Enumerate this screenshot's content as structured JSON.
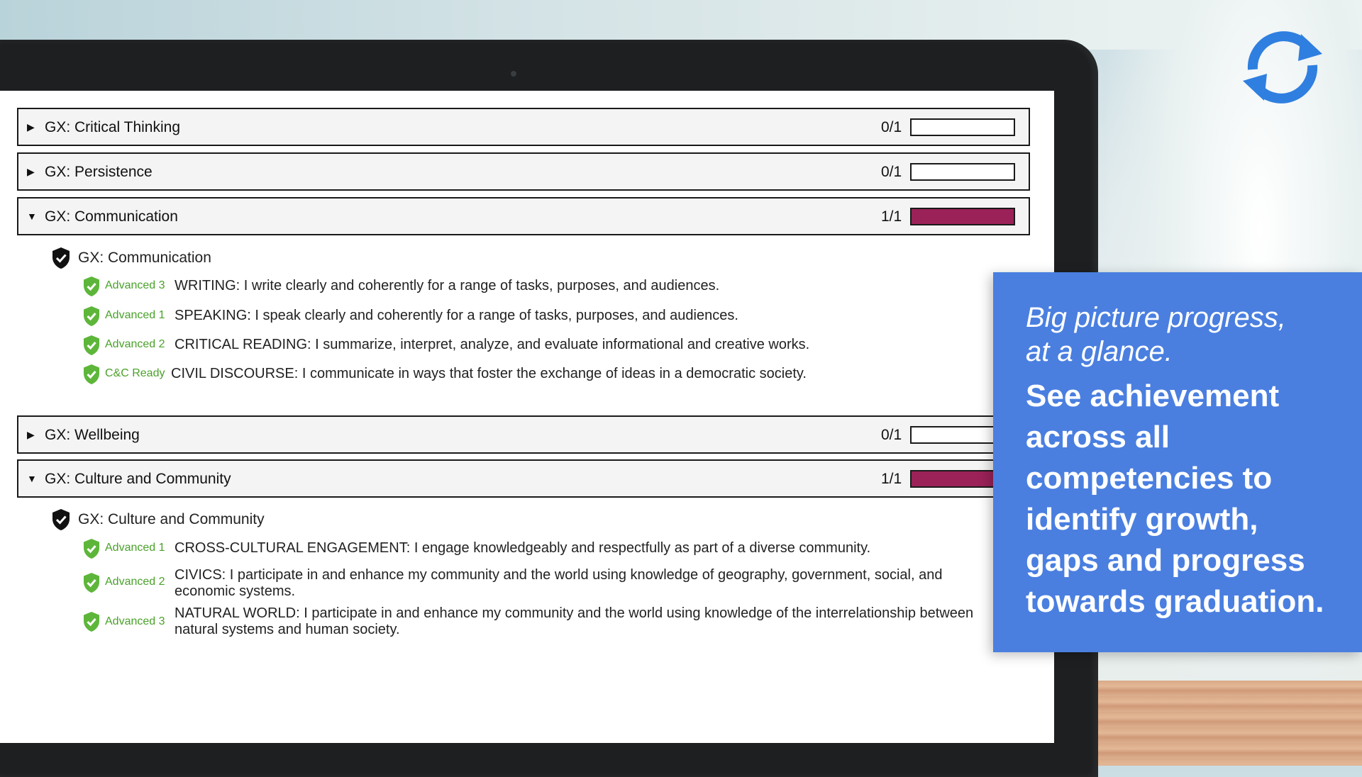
{
  "colors": {
    "progress_fill": "#9b2259",
    "level_green": "#4aa12a",
    "callout_bg": "#4a7fe0",
    "sync_icon": "#2f7fe0"
  },
  "icons": {
    "sync": "sync-icon",
    "collapsed": "caret-right-icon",
    "expanded": "caret-down-icon",
    "group_shield": "shield-check-icon",
    "standard_shield": "green-shield-check-icon"
  },
  "competencies": [
    {
      "title": "GX: Critical Thinking",
      "count": "0/1",
      "progress": 0,
      "expanded": false
    },
    {
      "title": "GX: Persistence",
      "count": "0/1",
      "progress": 0,
      "expanded": false
    },
    {
      "title": "GX: Communication",
      "count": "1/1",
      "progress": 1,
      "expanded": true,
      "group_title": "GX: Communication",
      "standards": [
        {
          "level": "Advanced 3",
          "text": "WRITING: I write clearly and coherently for a range of tasks, purposes, and audiences."
        },
        {
          "level": "Advanced 1",
          "text": "SPEAKING: I speak clearly and coherently for a range of tasks, purposes, and audiences."
        },
        {
          "level": "Advanced 2",
          "text": "CRITICAL READING: I summarize, interpret, analyze, and evaluate informational and creative works."
        },
        {
          "level": "C&C Ready",
          "text": "CIVIL DISCOURSE: I communicate in ways that foster the exchange of ideas in a democratic society."
        }
      ]
    },
    {
      "title": "GX: Wellbeing",
      "count": "0/1",
      "progress": 0,
      "expanded": false
    },
    {
      "title": "GX: Culture and Community",
      "count": "1/1",
      "progress": 1,
      "expanded": true,
      "group_title": "GX: Culture and Community",
      "standards": [
        {
          "level": "Advanced 1",
          "text": "CROSS-CULTURAL ENGAGEMENT: I engage knowledgeably and respectfully as part of a diverse community."
        },
        {
          "level": "Advanced 2",
          "text": "CIVICS: I participate in and enhance my community and the world using knowledge of geography, government, social, and economic systems."
        },
        {
          "level": "Advanced 3",
          "text": "NATURAL WORLD: I participate in and enhance my community and the world using knowledge of the interrelationship between natural systems and human society."
        }
      ]
    }
  ],
  "callout": {
    "line1": "Big picture progress,",
    "line2": "at a glance.",
    "body": [
      "See achievement",
      "across all",
      "competencies to",
      "identify growth,",
      "gaps and progress",
      "towards graduation."
    ]
  }
}
